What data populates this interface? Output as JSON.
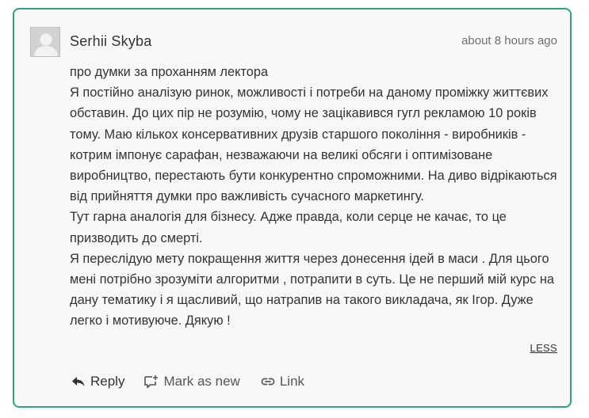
{
  "comment": {
    "author": "Serhii Skyba",
    "timestamp": "about 8 hours ago",
    "paragraphs": [
      "про думки за проханням лектора",
      "Я постійно аналізую ринок, можливості і потреби на даному проміжку життєвих обставин. До цих пір не розумію, чому не зацікавився гугл рекламою 10 років тому. Маю кількох консервативних друзів старшого покоління - виробників - котрим імпонує сарафан, незважаючи на великі обсяги і оптимізоване виробництво, перестають бути конкурентно спроможними. На диво відрікаються від прийняття думки про важливість сучасного маркетингу.",
      "Тут гарна аналогія для бізнесу. Адже правда, коли серце не качає, то це призводить до смерті.",
      "Я переслідую мету покращення життя через донесення ідей в маси . Для цього мені потрібно зрозуміти алгоритми , потрапити в суть. Це не перший мій курс на дану тематику і я щасливий, що натрапив на такого викладача, як Ігор. Дуже легко і мотивуюче. Дякую !"
    ],
    "less_label": "LESS"
  },
  "actions": {
    "reply": {
      "label": "Reply",
      "icon": "reply-arrow-icon"
    },
    "mark_as_new": {
      "label": "Mark as new",
      "icon": "comment-plus-icon"
    },
    "link": {
      "label": "Link",
      "icon": "chain-link-icon"
    }
  },
  "colors": {
    "border": "#2aa67f",
    "card_background": "#f8f8f8",
    "text": "#333333",
    "muted": "#6f6f6f"
  }
}
